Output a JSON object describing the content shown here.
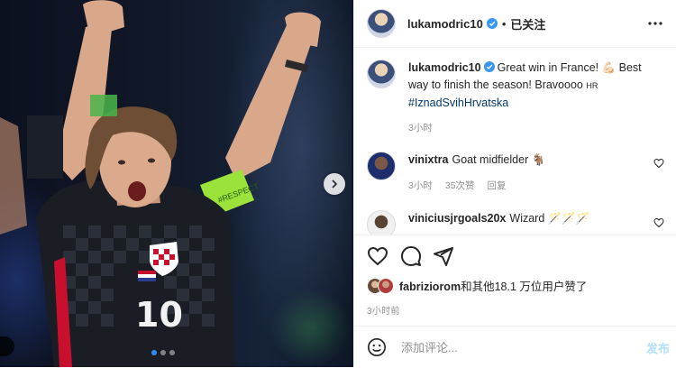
{
  "colors": {
    "accent": "#0095f6",
    "link": "#00376b",
    "muted": "#8e8e8e",
    "verified": "#3897f0",
    "jersey_accent": "#c8102e",
    "armband": "#9be23a"
  },
  "photo": {
    "jersey_number": "10",
    "armband_text": "#RESPECT",
    "carousel_dots": 3,
    "carousel_active_index": 0,
    "next_icon": "chevron-right-icon"
  },
  "header": {
    "username": "lukamodric10",
    "separator": "•",
    "follow_status": "已关注",
    "more_icon": "more-dots-icon"
  },
  "caption": {
    "username": "lukamodric10",
    "text": "Great win in France! 💪🏻 Best way to finish the season! Bravoooo ",
    "suffix": "HR",
    "hashtag": "#IznadSvihHrvatska",
    "time": "3小时"
  },
  "comments": [
    {
      "username": "vinixtra",
      "text": "Goat midfielder 🐐",
      "time": "3小时",
      "likes": "35次赞",
      "reply": "回复"
    },
    {
      "username": "viniciusjrgoals20x",
      "text": "Wizard 🪄🪄🪄"
    }
  ],
  "actions": {
    "like_icon": "heart-icon",
    "comment_icon": "comment-icon",
    "share_icon": "share-icon"
  },
  "likes": {
    "user": "fabriziorom",
    "rest": "和其他18.1 万位用户赞了"
  },
  "post_time": "3小时前",
  "add_comment": {
    "placeholder": "添加评论...",
    "post_label": "发布",
    "emoji_icon": "emoji-icon"
  }
}
